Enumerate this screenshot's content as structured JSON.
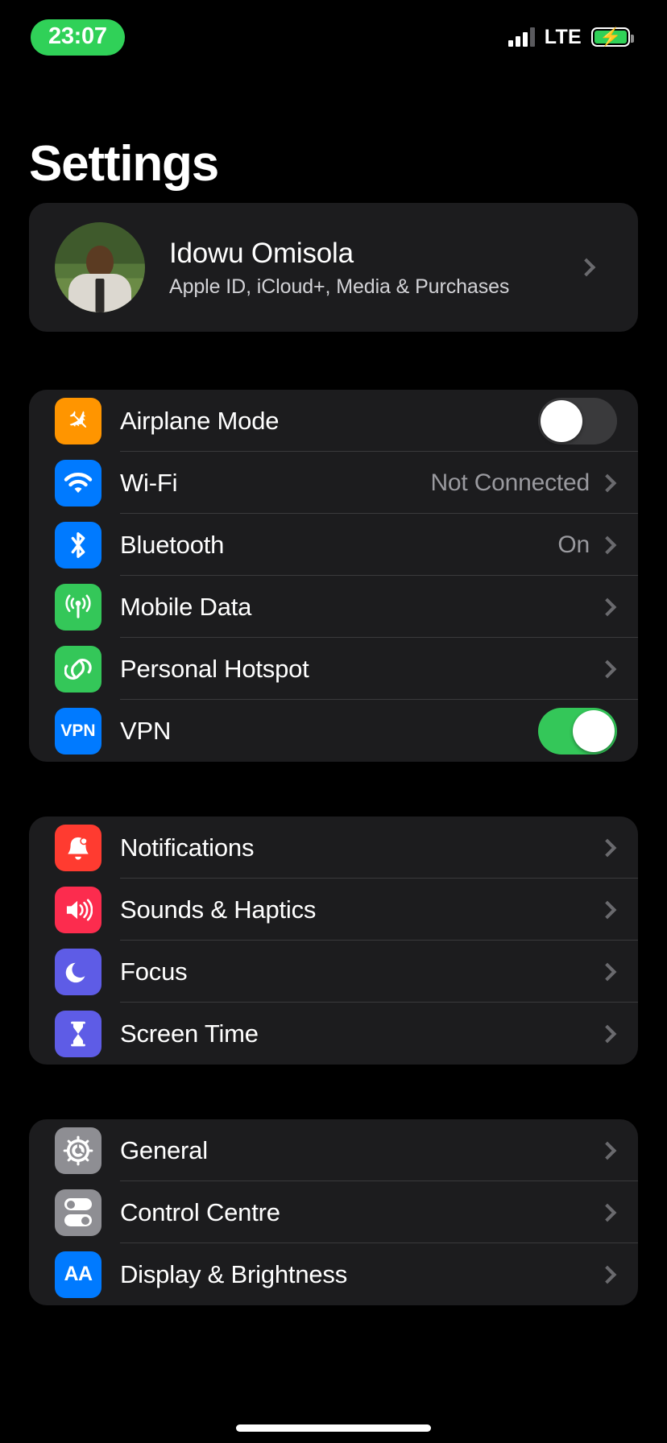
{
  "status_bar": {
    "time": "23:07",
    "time_pill_color": "#30d158",
    "network_label": "LTE",
    "battery_charging": true,
    "battery_color": "#30d158",
    "signal_bars_filled": 3,
    "signal_bars_total": 4
  },
  "header": {
    "title": "Settings"
  },
  "profile": {
    "name": "Idowu Omisola",
    "subtitle": "Apple ID, iCloud+, Media & Purchases"
  },
  "groups": [
    {
      "id": "connectivity",
      "rows": [
        {
          "label": "Airplane Mode",
          "icon": "airplane-icon",
          "icon_color": "#ff9500",
          "glyph": "✈",
          "control": "toggle",
          "toggle_on": false
        },
        {
          "label": "Wi-Fi",
          "icon": "wifi-icon",
          "icon_color": "#007aff",
          "glyph": "●",
          "control": "value",
          "value": "Not Connected"
        },
        {
          "label": "Bluetooth",
          "icon": "bluetooth-icon",
          "icon_color": "#007aff",
          "glyph": "ᛦ",
          "control": "value",
          "value": "On"
        },
        {
          "label": "Mobile Data",
          "icon": "mobile-data-icon",
          "icon_color": "#34c759",
          "glyph": "●",
          "control": "chevron",
          "value": ""
        },
        {
          "label": "Personal Hotspot",
          "icon": "personal-hotspot-icon",
          "icon_color": "#34c759",
          "glyph": "⚭",
          "control": "chevron",
          "value": ""
        },
        {
          "label": "VPN",
          "icon": "vpn-icon",
          "icon_color": "#007aff",
          "glyph": "VPN",
          "control": "toggle",
          "toggle_on": true
        }
      ]
    },
    {
      "id": "alerts",
      "rows": [
        {
          "label": "Notifications",
          "icon": "notifications-bell-icon",
          "icon_color": "#ff3b30",
          "glyph": "🔔",
          "control": "chevron",
          "value": ""
        },
        {
          "label": "Sounds & Haptics",
          "icon": "sounds-speaker-icon",
          "icon_color": "#fc2c4e",
          "glyph": "🔊",
          "control": "chevron",
          "value": ""
        },
        {
          "label": "Focus",
          "icon": "focus-moon-icon",
          "icon_color": "#5e5ce6",
          "glyph": "☾",
          "control": "chevron",
          "value": ""
        },
        {
          "label": "Screen Time",
          "icon": "screen-time-hourglass-icon",
          "icon_color": "#5e5ce6",
          "glyph": "⧗",
          "control": "chevron",
          "value": ""
        }
      ]
    },
    {
      "id": "system",
      "rows": [
        {
          "label": "General",
          "icon": "general-gear-icon",
          "icon_color": "#8e8e93",
          "glyph": "⚙",
          "control": "chevron",
          "value": ""
        },
        {
          "label": "Control Centre",
          "icon": "control-centre-toggles-icon",
          "icon_color": "#8e8e93",
          "glyph": "",
          "control": "chevron",
          "value": ""
        },
        {
          "label": "Display & Brightness",
          "icon": "display-brightness-aa-icon",
          "icon_color": "#007aff",
          "glyph": "AA",
          "control": "chevron",
          "value": ""
        }
      ]
    }
  ]
}
